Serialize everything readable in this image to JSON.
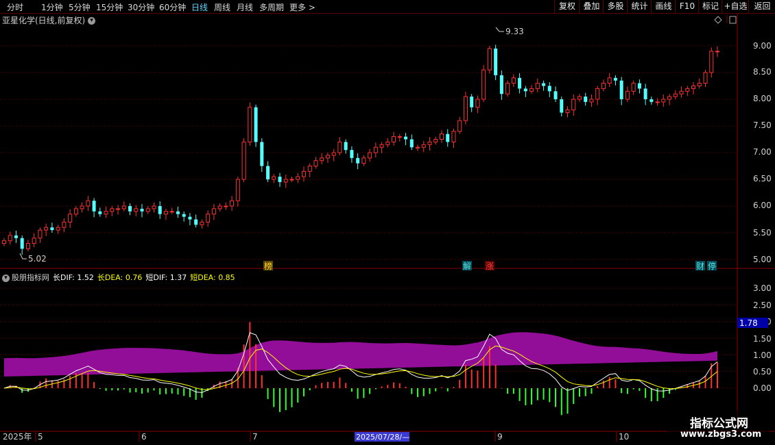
{
  "toolbar": {
    "periods": [
      "分时",
      "1分钟",
      "5分钟",
      "15分钟",
      "30分钟",
      "60分钟",
      "日线",
      "周线",
      "月线",
      "多周期",
      "更多 >"
    ],
    "active": "日线",
    "buttons": [
      "复权",
      "叠加",
      "多股",
      "统计",
      "画线",
      "F10",
      "标记",
      "+自选",
      "返回"
    ]
  },
  "header": {
    "title": "亚星化学(日线,前复权)"
  },
  "price_axis": {
    "ticks": [
      "9.00",
      "8.50",
      "8.00",
      "7.50",
      "7.00",
      "6.50",
      "6.00",
      "5.50",
      "5.00"
    ]
  },
  "annotations": {
    "high": "9.33",
    "low": "5.02"
  },
  "event_markers": [
    "榜",
    "解",
    "涨",
    "财",
    "停"
  ],
  "indicator": {
    "name": "股朋指标网",
    "items": [
      {
        "label": "长DIF: 1.52",
        "color": "#ffffff"
      },
      {
        "label": "长DEA: 0.76",
        "color": "#ffff00"
      },
      {
        "label": "短DIF: 1.37",
        "color": "#ffffff"
      },
      {
        "label": "短DEA: 0.85",
        "color": "#ffff00"
      }
    ],
    "axis_ticks": [
      "3.00",
      "2.50",
      "2.00",
      "1.50",
      "1.00",
      "0.50",
      "0.00"
    ],
    "current_value": "1.78"
  },
  "time_axis": {
    "labels": [
      "2025年",
      "5",
      "6",
      "7",
      "9",
      "10"
    ],
    "cursor": "2025/07/28/—"
  },
  "watermark": {
    "line1": "指标公式网",
    "line2": "www.zbgs3.com"
  },
  "chart_data": [
    {
      "type": "candlestick",
      "title": "亚星化学(日线,前复权)",
      "ylim": [
        4.8,
        9.6
      ],
      "y_ticks": [
        5.0,
        5.5,
        6.0,
        6.5,
        7.0,
        7.5,
        8.0,
        8.5,
        9.0
      ],
      "marked_high": 9.33,
      "marked_low": 5.02,
      "close_series": [
        5.35,
        5.45,
        5.4,
        5.2,
        5.3,
        5.4,
        5.55,
        5.6,
        5.55,
        5.6,
        5.7,
        5.85,
        5.95,
        6.0,
        6.1,
        5.9,
        5.85,
        5.9,
        5.95,
        5.95,
        6.0,
        5.9,
        5.95,
        5.9,
        5.95,
        6.0,
        5.85,
        5.9,
        5.9,
        5.85,
        5.8,
        5.75,
        5.65,
        5.7,
        5.85,
        5.95,
        6.0,
        6.0,
        6.1,
        6.5,
        7.2,
        7.85,
        7.2,
        6.75,
        6.5,
        6.55,
        6.45,
        6.5,
        6.5,
        6.55,
        6.65,
        6.75,
        6.85,
        6.9,
        6.95,
        7.0,
        7.2,
        7.05,
        6.9,
        6.8,
        6.9,
        7.0,
        7.1,
        7.15,
        7.2,
        7.3,
        7.3,
        7.25,
        7.1,
        7.1,
        7.15,
        7.2,
        7.25,
        7.35,
        7.2,
        7.4,
        7.6,
        8.05,
        7.85,
        8.0,
        8.55,
        8.95,
        8.45,
        8.1,
        8.3,
        8.4,
        8.2,
        8.15,
        8.2,
        8.3,
        8.25,
        8.15,
        8.0,
        7.75,
        7.8,
        8.0,
        8.05,
        7.95,
        8.0,
        8.2,
        8.3,
        8.4,
        8.35,
        8.0,
        8.15,
        8.3,
        8.2,
        8.0,
        7.95,
        7.95,
        8.0,
        8.05,
        8.1,
        8.15,
        8.2,
        8.25,
        8.3,
        8.5,
        8.9,
        8.9
      ]
    },
    {
      "type": "bar+line",
      "title": "股朋指标网",
      "ylim": [
        -1.0,
        3.2
      ],
      "y_ticks": [
        0.0,
        0.5,
        1.0,
        1.5,
        2.0,
        2.5,
        3.0
      ],
      "series": [
        {
          "name": "长DIF",
          "last": 1.52
        },
        {
          "name": "长DEA",
          "last": 0.76
        },
        {
          "name": "短DIF",
          "last": 1.37
        },
        {
          "name": "短DEA",
          "last": 0.85
        }
      ]
    }
  ]
}
